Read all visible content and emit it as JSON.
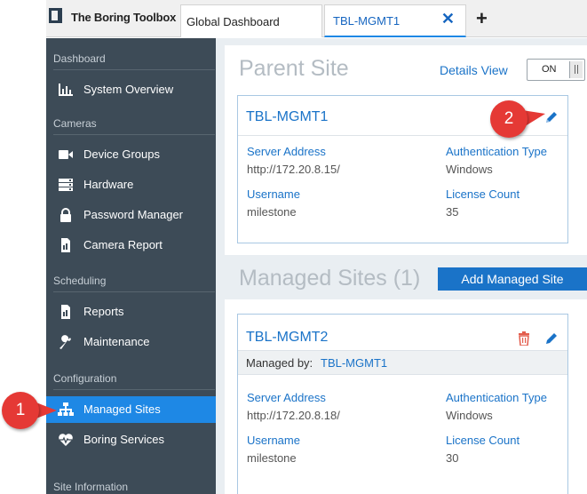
{
  "app": {
    "title": "The Boring Toolbox"
  },
  "tabs": [
    {
      "label": "Global Dashboard"
    },
    {
      "label": "TBL-MGMT1",
      "close": "✕"
    }
  ],
  "add_tab_symbol": "+",
  "sidebar": {
    "sections": [
      {
        "header": "Dashboard",
        "items": [
          {
            "label": "System Overview",
            "icon": "bar-chart-icon"
          }
        ]
      },
      {
        "header": "Cameras",
        "items": [
          {
            "label": "Device Groups",
            "icon": "video-camera-icon"
          },
          {
            "label": "Hardware",
            "icon": "server-icon"
          },
          {
            "label": "Password Manager",
            "icon": "lock-icon"
          },
          {
            "label": "Camera Report",
            "icon": "report-icon"
          }
        ]
      },
      {
        "header": "Scheduling",
        "items": [
          {
            "label": "Reports",
            "icon": "report-icon"
          },
          {
            "label": "Maintenance",
            "icon": "wrench-icon"
          }
        ]
      },
      {
        "header": "Configuration",
        "items": [
          {
            "label": "Managed Sites",
            "icon": "sitemap-icon",
            "active": true
          },
          {
            "label": "Boring Services",
            "icon": "heartbeat-icon"
          }
        ]
      },
      {
        "header": "Site Information",
        "items": []
      }
    ]
  },
  "parent_site": {
    "title": "Parent Site",
    "details_view_label": "Details View",
    "toggle_label": "ON",
    "card": {
      "name": "TBL-MGMT1",
      "server_address_label": "Server Address",
      "server_address": "http://172.20.8.15/",
      "auth_type_label": "Authentication Type",
      "auth_type": "Windows",
      "username_label": "Username",
      "username": "milestone",
      "license_count_label": "License Count",
      "license_count": "35"
    }
  },
  "managed_sites": {
    "title": "Managed Sites (1)",
    "add_button_label": "Add Managed Site",
    "cards": [
      {
        "name": "TBL-MGMT2",
        "managed_by_label": "Managed by:",
        "managed_by": "TBL-MGMT1",
        "server_address_label": "Server Address",
        "server_address": "http://172.20.8.18/",
        "auth_type_label": "Authentication Type",
        "auth_type": "Windows",
        "username_label": "Username",
        "username": "milestone",
        "license_count_label": "License Count",
        "license_count": "30"
      }
    ]
  },
  "callouts": [
    {
      "number": "1"
    },
    {
      "number": "2"
    }
  ],
  "colors": {
    "accent": "#1e88e5",
    "sidebar": "#3d4b57",
    "link": "#1a73c8",
    "callout": "#e53935",
    "delete": "#e35d4d"
  }
}
